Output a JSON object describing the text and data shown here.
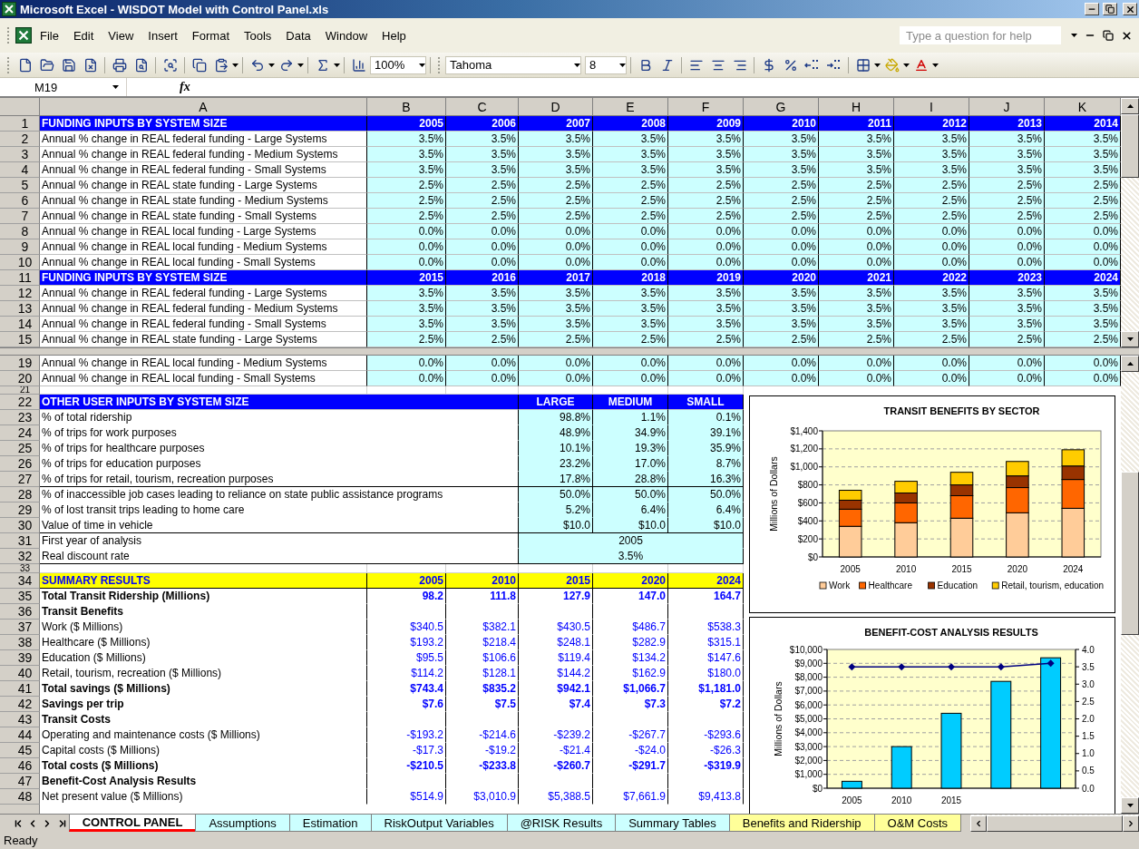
{
  "window": {
    "title": "Microsoft Excel - WISDOT Model with Control Panel.xls"
  },
  "menu": [
    "File",
    "Edit",
    "View",
    "Insert",
    "Format",
    "Tools",
    "Data",
    "Window",
    "Help"
  ],
  "help_field": {
    "placeholder": "Type a question for help"
  },
  "toolbar": {
    "zoom": "100%",
    "font": "Tahoma",
    "font_size": "8"
  },
  "formula_bar": {
    "name_box": "M19",
    "function_label": "fx"
  },
  "columns": [
    "A",
    "B",
    "C",
    "D",
    "E",
    "F",
    "G",
    "H",
    "I",
    "J",
    "K"
  ],
  "top_pane": [
    {
      "number": "1",
      "kind": "header",
      "label": "FUNDING INPUTS BY SYSTEM SIZE",
      "values": [
        "2005",
        "2006",
        "2007",
        "2008",
        "2009",
        "2010",
        "2011",
        "2012",
        "2013",
        "2014"
      ]
    },
    {
      "number": "2",
      "kind": "data",
      "label": "Annual % change in REAL federal funding - Large Systems",
      "values": [
        "3.5%",
        "3.5%",
        "3.5%",
        "3.5%",
        "3.5%",
        "3.5%",
        "3.5%",
        "3.5%",
        "3.5%",
        "3.5%"
      ]
    },
    {
      "number": "3",
      "kind": "data",
      "label": "Annual % change in REAL federal funding - Medium Systems",
      "values": [
        "3.5%",
        "3.5%",
        "3.5%",
        "3.5%",
        "3.5%",
        "3.5%",
        "3.5%",
        "3.5%",
        "3.5%",
        "3.5%"
      ]
    },
    {
      "number": "4",
      "kind": "data",
      "label": "Annual % change in REAL federal funding - Small Systems",
      "values": [
        "3.5%",
        "3.5%",
        "3.5%",
        "3.5%",
        "3.5%",
        "3.5%",
        "3.5%",
        "3.5%",
        "3.5%",
        "3.5%"
      ]
    },
    {
      "number": "5",
      "kind": "data",
      "label": "Annual % change in REAL state funding - Large Systems",
      "values": [
        "2.5%",
        "2.5%",
        "2.5%",
        "2.5%",
        "2.5%",
        "2.5%",
        "2.5%",
        "2.5%",
        "2.5%",
        "2.5%"
      ]
    },
    {
      "number": "6",
      "kind": "data",
      "label": "Annual % change in REAL state funding - Medium Systems",
      "values": [
        "2.5%",
        "2.5%",
        "2.5%",
        "2.5%",
        "2.5%",
        "2.5%",
        "2.5%",
        "2.5%",
        "2.5%",
        "2.5%"
      ]
    },
    {
      "number": "7",
      "kind": "data",
      "label": "Annual % change in REAL state funding - Small Systems",
      "values": [
        "2.5%",
        "2.5%",
        "2.5%",
        "2.5%",
        "2.5%",
        "2.5%",
        "2.5%",
        "2.5%",
        "2.5%",
        "2.5%"
      ]
    },
    {
      "number": "8",
      "kind": "data",
      "label": "Annual % change in REAL local funding - Large Systems",
      "values": [
        "0.0%",
        "0.0%",
        "0.0%",
        "0.0%",
        "0.0%",
        "0.0%",
        "0.0%",
        "0.0%",
        "0.0%",
        "0.0%"
      ]
    },
    {
      "number": "9",
      "kind": "data",
      "label": "Annual % change in REAL local funding - Medium Systems",
      "values": [
        "0.0%",
        "0.0%",
        "0.0%",
        "0.0%",
        "0.0%",
        "0.0%",
        "0.0%",
        "0.0%",
        "0.0%",
        "0.0%"
      ]
    },
    {
      "number": "10",
      "kind": "data",
      "label": "Annual % change in REAL local funding - Small Systems",
      "values": [
        "0.0%",
        "0.0%",
        "0.0%",
        "0.0%",
        "0.0%",
        "0.0%",
        "0.0%",
        "0.0%",
        "0.0%",
        "0.0%"
      ]
    },
    {
      "number": "11",
      "kind": "header",
      "label": "FUNDING INPUTS BY SYSTEM SIZE",
      "values": [
        "2015",
        "2016",
        "2017",
        "2018",
        "2019",
        "2020",
        "2021",
        "2022",
        "2023",
        "2024"
      ]
    },
    {
      "number": "12",
      "kind": "data",
      "label": "Annual % change in REAL federal funding - Large Systems",
      "values": [
        "3.5%",
        "3.5%",
        "3.5%",
        "3.5%",
        "3.5%",
        "3.5%",
        "3.5%",
        "3.5%",
        "3.5%",
        "3.5%"
      ]
    },
    {
      "number": "13",
      "kind": "data",
      "label": "Annual % change in REAL federal funding - Medium Systems",
      "values": [
        "3.5%",
        "3.5%",
        "3.5%",
        "3.5%",
        "3.5%",
        "3.5%",
        "3.5%",
        "3.5%",
        "3.5%",
        "3.5%"
      ]
    },
    {
      "number": "14",
      "kind": "data",
      "label": "Annual % change in REAL federal funding - Small Systems",
      "values": [
        "3.5%",
        "3.5%",
        "3.5%",
        "3.5%",
        "3.5%",
        "3.5%",
        "3.5%",
        "3.5%",
        "3.5%",
        "3.5%"
      ]
    },
    {
      "number": "15",
      "kind": "data",
      "label": "Annual % change in REAL state funding - Large Systems",
      "values": [
        "2.5%",
        "2.5%",
        "2.5%",
        "2.5%",
        "2.5%",
        "2.5%",
        "2.5%",
        "2.5%",
        "2.5%",
        "2.5%"
      ]
    }
  ],
  "bottom_pane": [
    {
      "number": "19",
      "kind": "data",
      "label": "Annual % change in REAL local funding - Medium Systems",
      "values": [
        "0.0%",
        "0.0%",
        "0.0%",
        "0.0%",
        "0.0%",
        "0.0%",
        "0.0%",
        "0.0%",
        "0.0%",
        "0.0%"
      ]
    },
    {
      "number": "20",
      "kind": "data",
      "label": "Annual % change in REAL local funding - Small Systems",
      "values": [
        "0.0%",
        "0.0%",
        "0.0%",
        "0.0%",
        "0.0%",
        "0.0%",
        "0.0%",
        "0.0%",
        "0.0%",
        "0.0%"
      ]
    }
  ],
  "spacer_row_1": {
    "number": "21"
  },
  "other_inputs": {
    "number": "22",
    "title": "OTHER USER INPUTS BY SYSTEM SIZE",
    "headers": [
      "LARGE",
      "MEDIUM",
      "SMALL"
    ],
    "rows": [
      {
        "number": "23",
        "label": "% of total ridership",
        "values": [
          "98.8%",
          "1.1%",
          "0.1%"
        ]
      },
      {
        "number": "24",
        "label": "% of trips for work purposes",
        "values": [
          "48.9%",
          "34.9%",
          "39.1%"
        ]
      },
      {
        "number": "25",
        "label": "% of trips for healthcare purposes",
        "values": [
          "10.1%",
          "19.3%",
          "35.9%"
        ]
      },
      {
        "number": "26",
        "label": "% of trips for education purposes",
        "values": [
          "23.2%",
          "17.0%",
          "8.7%"
        ]
      },
      {
        "number": "27",
        "label": "% of trips for retail, tourism, recreation purposes",
        "values": [
          "17.8%",
          "28.8%",
          "16.3%"
        ]
      },
      {
        "number": "28",
        "label": "% of inaccessible job cases leading to reliance on state public assistance programs",
        "values": [
          "50.0%",
          "50.0%",
          "50.0%"
        ]
      },
      {
        "number": "29",
        "label": "% of lost transit trips leading to home care",
        "values": [
          "5.2%",
          "6.4%",
          "6.4%"
        ]
      },
      {
        "number": "30",
        "label": "Value of time in vehicle",
        "values": [
          "$10.0",
          "$10.0",
          "$10.0"
        ]
      }
    ],
    "single_rows": [
      {
        "number": "31",
        "label": "First year of analysis",
        "value": "2005"
      },
      {
        "number": "32",
        "label": "Real discount rate",
        "value": "3.5%"
      }
    ]
  },
  "spacer_row_2": {
    "number": "33"
  },
  "summary": [
    {
      "number": "34",
      "kind": "header",
      "label": "SUMMARY RESULTS",
      "values": [
        "2005",
        "2010",
        "2015",
        "2020",
        "2024"
      ]
    },
    {
      "number": "35",
      "kind": "bold",
      "label": "Total Transit Ridership (Millions)",
      "values": [
        "98.2",
        "111.8",
        "127.9",
        "147.0",
        "164.7"
      ]
    },
    {
      "number": "36",
      "kind": "section",
      "label": "Transit Benefits"
    },
    {
      "number": "37",
      "kind": "data",
      "label": "Work ($ Millions)",
      "values": [
        "$340.5",
        "$382.1",
        "$430.5",
        "$486.7",
        "$538.3"
      ]
    },
    {
      "number": "38",
      "kind": "data",
      "label": "Healthcare ($ Millions)",
      "values": [
        "$193.2",
        "$218.4",
        "$248.1",
        "$282.9",
        "$315.1"
      ]
    },
    {
      "number": "39",
      "kind": "data",
      "label": "Education ($ Millions)",
      "values": [
        "$95.5",
        "$106.6",
        "$119.4",
        "$134.2",
        "$147.6"
      ]
    },
    {
      "number": "40",
      "kind": "data",
      "label": "Retail, tourism, recreation ($ Millions)",
      "values": [
        "$114.2",
        "$128.1",
        "$144.2",
        "$162.9",
        "$180.0"
      ]
    },
    {
      "number": "41",
      "kind": "bold",
      "label": "Total savings ($ Millions)",
      "values": [
        "$743.4",
        "$835.2",
        "$942.1",
        "$1,066.7",
        "$1,181.0"
      ]
    },
    {
      "number": "42",
      "kind": "bold",
      "label": "Savings per trip",
      "values": [
        "$7.6",
        "$7.5",
        "$7.4",
        "$7.3",
        "$7.2"
      ]
    },
    {
      "number": "43",
      "kind": "section",
      "label": "Transit Costs"
    },
    {
      "number": "44",
      "kind": "data",
      "label": "Operating and maintenance costs ($ Millions)",
      "values": [
        "-$193.2",
        "-$214.6",
        "-$239.2",
        "-$267.7",
        "-$293.6"
      ]
    },
    {
      "number": "45",
      "kind": "data",
      "label": "Capital costs ($ Millions)",
      "values": [
        "-$17.3",
        "-$19.2",
        "-$21.4",
        "-$24.0",
        "-$26.3"
      ]
    },
    {
      "number": "46",
      "kind": "bold",
      "label": "Total costs ($ Millions)",
      "values": [
        "-$210.5",
        "-$233.8",
        "-$260.7",
        "-$291.7",
        "-$319.9"
      ]
    },
    {
      "number": "47",
      "kind": "section",
      "label": "Benefit-Cost Analysis Results"
    },
    {
      "number": "48",
      "kind": "data",
      "label": "Net present value ($ Millions)",
      "values": [
        "$514.9",
        "$3,010.9",
        "$5,388.5",
        "$7,661.9",
        "$9,413.8"
      ]
    }
  ],
  "charts": [
    {
      "chart_data": {
        "type": "bar",
        "stacked": true,
        "grid": true,
        "legend": "bottom",
        "title": "TRANSIT BENEFITS BY SECTOR",
        "ylabel": "Millions of Dollars",
        "categories": [
          "2005",
          "2010",
          "2015",
          "2020",
          "2024"
        ],
        "ylim": [
          0,
          1400
        ],
        "yticks": [
          {
            "value": 0,
            "label": "$0"
          },
          {
            "value": 200,
            "label": "$200"
          },
          {
            "value": 400,
            "label": "$400"
          },
          {
            "value": 600,
            "label": "$600"
          },
          {
            "value": 800,
            "label": "$800"
          },
          {
            "value": 1000,
            "label": "$1,000"
          },
          {
            "value": 1200,
            "label": "$1,200"
          },
          {
            "value": 1400,
            "label": "$1,400"
          }
        ],
        "series": [
          {
            "name": "Work",
            "color": "#ffcc99",
            "values": [
              340,
              380,
              430,
              490,
              540
            ]
          },
          {
            "name": "Healthcare",
            "color": "#ff6600",
            "values": [
              190,
              220,
              250,
              280,
              320
            ]
          },
          {
            "name": "Education",
            "color": "#993300",
            "values": [
              100,
              110,
              120,
              130,
              150
            ]
          },
          {
            "name": "Retail, tourism, education",
            "color": "#ffcc00",
            "values": [
              110,
              130,
              140,
              160,
              180
            ]
          }
        ]
      }
    },
    {
      "chart_data": {
        "type": "bar",
        "stacked": false,
        "grid": true,
        "title": "BENEFIT-COST ANALYSIS RESULTS",
        "ylabel": "Millions of Dollars",
        "categories": [
          "2005",
          "2010",
          "2015",
          null,
          null
        ],
        "ylim": [
          0,
          10000
        ],
        "yticks": [
          {
            "value": 0,
            "label": "$0"
          },
          {
            "value": 1000,
            "label": "$1,000"
          },
          {
            "value": 2000,
            "label": "$2,000"
          },
          {
            "value": 3000,
            "label": "$3,000"
          },
          {
            "value": 4000,
            "label": "$4,000"
          },
          {
            "value": 5000,
            "label": "$5,000"
          },
          {
            "value": 6000,
            "label": "$6,000"
          },
          {
            "value": 7000,
            "label": "$7,000"
          },
          {
            "value": 8000,
            "label": "$8,000"
          },
          {
            "value": 9000,
            "label": "$9,000"
          },
          {
            "value": 10000,
            "label": "$10,000"
          }
        ],
        "y2lim": [
          0,
          4
        ],
        "y2ticks": [
          {
            "value": 0,
            "label": "0.0"
          },
          {
            "value": 0.5,
            "label": "0.5"
          },
          {
            "value": 1,
            "label": "1.0"
          },
          {
            "value": 1.5,
            "label": "1.5"
          },
          {
            "value": 2,
            "label": "2.0"
          },
          {
            "value": 2.5,
            "label": "2.5"
          },
          {
            "value": 3,
            "label": "3.0"
          },
          {
            "value": 3.5,
            "label": "3.5"
          },
          {
            "value": 4,
            "label": "4.0"
          }
        ],
        "series": [
          {
            "type": "bar",
            "color": "#00ccff",
            "values": [
              500,
              3000,
              5400,
              7700,
              9400
            ]
          },
          {
            "type": "line",
            "axis": "y2",
            "marker": "diamond",
            "color": "#000080",
            "values": [
              3.5,
              3.5,
              3.5,
              3.5,
              3.6
            ]
          }
        ]
      }
    }
  ],
  "sheet_tabs": [
    {
      "label": "CONTROL PANEL",
      "selected": true,
      "color": "#ff0000"
    },
    {
      "label": "Assumptions",
      "selected": false,
      "color": "#ccffff"
    },
    {
      "label": "Estimation",
      "selected": false,
      "color": "#ccffff"
    },
    {
      "label": "RiskOutput Variables",
      "selected": false,
      "color": "#ccffff"
    },
    {
      "label": "@RISK Results",
      "selected": false,
      "color": "#ccffff"
    },
    {
      "label": "Summary Tables",
      "selected": false,
      "color": "#ccffff"
    },
    {
      "label": "Benefits and Ridership",
      "selected": false,
      "color": "#ffff99"
    },
    {
      "label": "O&M Costs",
      "selected": false,
      "color": "#ffff99"
    }
  ],
  "status_bar": {
    "text": "Ready"
  }
}
